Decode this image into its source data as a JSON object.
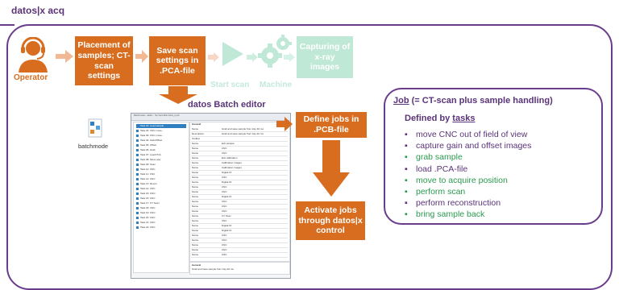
{
  "title": "datos|x acq",
  "operator_label": "Operator",
  "steps": {
    "placement": "Placement of samples; CT-scan settings",
    "save_scan": "Save scan settings in .PCA-file",
    "start_scan": "Start scan",
    "machine": "Machine",
    "capturing": "Capturing of x-ray images"
  },
  "batch_editor_title": "datos Batch editor",
  "batchmode_label": "batchmode",
  "define_jobs": "Define jobs in .PCB-file",
  "activate_jobs": "Activate jobs through datos|x control",
  "job_panel": {
    "job_word": "Job",
    "job_rest": " (= CT-scan plus sample handling)",
    "defined_by": "Defined by ",
    "tasks_word": "tasks",
    "tasks": [
      {
        "text": "move CNC out of field of view",
        "color": "#5a3378"
      },
      {
        "text": "capture gain and offset images",
        "color": "#5a3378"
      },
      {
        "text": "grab sample",
        "color": "#2a9a4e"
      },
      {
        "text": "load .PCA-file",
        "color": "#5a3378"
      },
      {
        "text": "move to acquire position",
        "color": "#2a9a4e"
      },
      {
        "text": "perform scan",
        "color": "#2a9a4e"
      },
      {
        "text": "perform reconstruction",
        "color": "#5a3378"
      },
      {
        "text": "bring sample back",
        "color": "#2a9a4e"
      }
    ]
  },
  "colors": {
    "accent_orange": "#d86d1f",
    "accent_purple": "#6a3d8c",
    "faded_green": "#bfe8d6",
    "task_green": "#2a9a4e"
  },
  "editor_window": {
    "titlebar": "Batchmodus - Editor - Top.Verw.Mob.Parts_1.pcb",
    "list_items": [
      "Task 01: Load sample",
      "Task 02: CNC move...",
      "Task 03: CNC move...",
      "Task 04: Gain/Offset",
      "Task 05: Offset",
      "Task 06: Grab",
      "Task 07: Load PCA",
      "Task 08: Move acq",
      "Task 09: Scan",
      "Task 10: CNC",
      "Task 11: CNC",
      "Task 12: CNC",
      "Task 13: Recon",
      "Task 14: CNC",
      "Task 15: CNC",
      "Task 16: CNC",
      "Task 17: CT Scan",
      "Task 18: CNC",
      "Task 19: CNC",
      "Task 20: CNC",
      "Task 21: CNC",
      "Task 22: CNC"
    ],
    "right_header": "General",
    "grid_rows": [
      [
        "Name",
        "Grab and save sample from tray 40 ms"
      ],
      [
        "Description",
        "Grab and save sample from tray 40 ms"
      ],
      [
        "Toolbar",
        ""
      ],
      [
        "Name",
        "Exit sample"
      ],
      [
        "Name",
        "CNC"
      ],
      [
        "Name",
        "CNC"
      ],
      [
        "Name",
        "Exit calibration"
      ],
      [
        "Name",
        "Calibration images"
      ],
      [
        "Name",
        "Calibration images"
      ],
      [
        "Name",
        "Digital IO"
      ],
      [
        "Name",
        "CNC"
      ],
      [
        "Name",
        "Digital IO"
      ],
      [
        "Name",
        "CNC"
      ],
      [
        "Name",
        "CNC"
      ],
      [
        "Name",
        "Digital IO"
      ],
      [
        "Name",
        "CNC"
      ],
      [
        "Name",
        "CNC"
      ],
      [
        "Name",
        "CNC"
      ],
      [
        "Name",
        "CT Scan"
      ],
      [
        "Name",
        "CNC"
      ],
      [
        "Name",
        "Digital IO"
      ],
      [
        "Name",
        "Digital IO"
      ],
      [
        "Name",
        "CNC"
      ],
      [
        "Name",
        "CNC"
      ],
      [
        "Name",
        "CNC"
      ],
      [
        "Name",
        "CNC"
      ],
      [
        "Name",
        "CNC"
      ]
    ],
    "footer_label": "General",
    "footer_text": "Grab and save sample from tray 40 ms"
  }
}
